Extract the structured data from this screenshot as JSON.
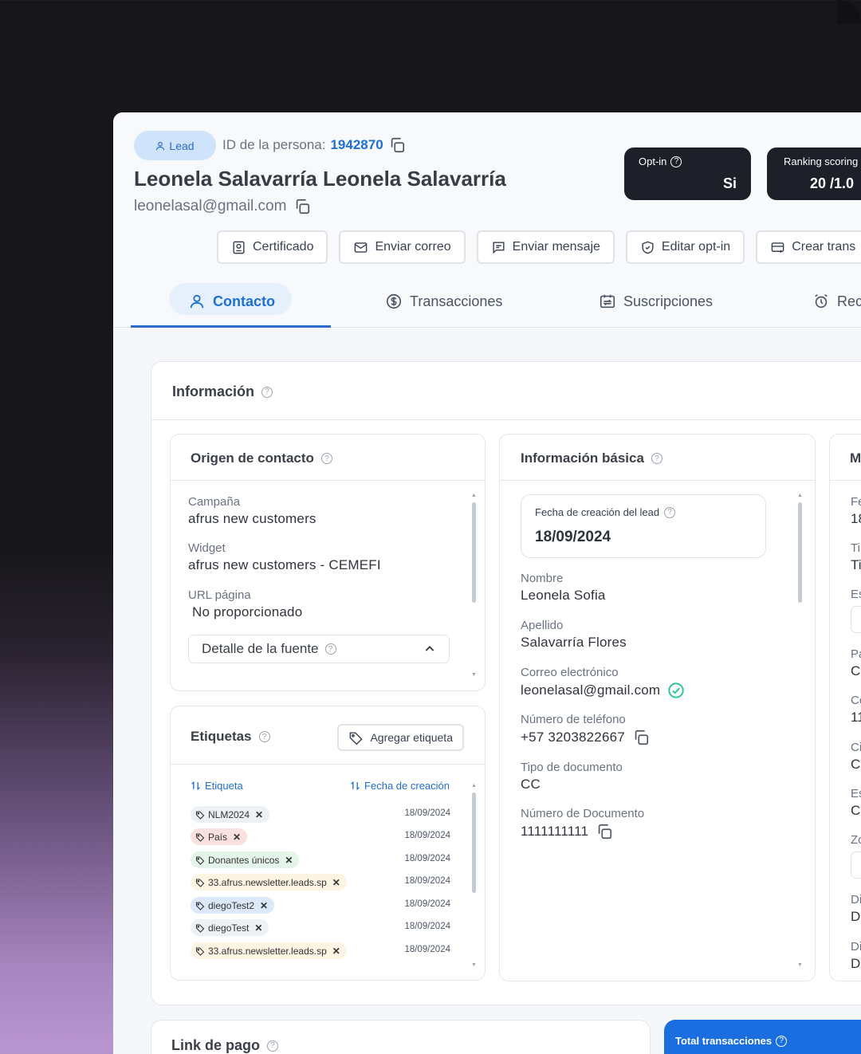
{
  "header": {
    "badge_label": "Lead",
    "person_id_label": "ID de la persona:",
    "person_id_value": "1942870",
    "name": "Leonela Salavarría Leonela Salavarría",
    "email": "leonelasal@gmail.com",
    "optin": {
      "label": "Opt-in",
      "value": "Si"
    },
    "ranking": {
      "label": "Ranking scoring",
      "value": "20  /1.0"
    }
  },
  "actions": {
    "certificado": "Certificado",
    "enviar_correo": "Enviar correo",
    "enviar_mensaje": "Enviar mensaje",
    "editar_optin": "Editar opt-in",
    "crear_trans": "Crear trans"
  },
  "tabs": {
    "contacto": "Contacto",
    "transacciones": "Transacciones",
    "suscripciones": "Suscripciones",
    "rec": "Rec"
  },
  "informacion": {
    "title": "Información",
    "origen": {
      "title": "Origen de contacto",
      "campana_label": "Campaña",
      "campana_value": "afrus new customers",
      "widget_label": "Widget",
      "widget_value": "afrus new customers - CEMEFI",
      "url_label": "URL página",
      "url_value": "No proporcionado",
      "detalle_label": "Detalle de la fuente"
    },
    "etiquetas": {
      "title": "Etiquetas",
      "add_label": "Agregar etiqueta",
      "col_tag": "Etiqueta",
      "col_date": "Fecha de creación",
      "rows": [
        {
          "tag": "NLM2024",
          "date": "18/09/2024",
          "color": "#eef1f4"
        },
        {
          "tag": "País",
          "date": "18/09/2024",
          "color": "#fbe0e0"
        },
        {
          "tag": "Donantes únicos",
          "date": "18/09/2024",
          "color": "#e4f6ea"
        },
        {
          "tag": "33.afrus.newsletter.leads.sp",
          "date": "18/09/2024",
          "color": "#fdf4e4"
        },
        {
          "tag": "diegoTest2",
          "date": "18/09/2024",
          "color": "#dbe9fb"
        },
        {
          "tag": "diegoTest",
          "date": "18/09/2024",
          "color": "#eef1f4"
        },
        {
          "tag": "33.afrus.newsletter.leads.sp",
          "date": "18/09/2024",
          "color": "#fdf4e4"
        }
      ]
    },
    "basica": {
      "title": "Información básica",
      "fecha_label": "Fecha de creación del lead",
      "fecha_value": "18/09/2024",
      "nombre_label": "Nombre",
      "nombre_value": "Leonela Sofia",
      "apellido_label": "Apellido",
      "apellido_value": "Salavarría Flores",
      "correo_label": "Correo electrónico",
      "correo_value": "leonelasal@gmail.com",
      "telefono_label": "Número de teléfono",
      "telefono_value": "+57 3203822667",
      "tipo_doc_label": "Tipo de documento",
      "tipo_doc_value": "CC",
      "num_doc_label": "Número de Documento",
      "num_doc_value": "1111111111"
    },
    "third": {
      "title_fragment": "M",
      "fragments": [
        "Fe",
        "18",
        "Ti",
        "Ti",
        "Es",
        "Pa",
        "Cc",
        "Cc",
        "11",
        "Ci",
        "Cc",
        "Es",
        "Cc",
        "Zc",
        "Di",
        "Di",
        "Di",
        "Di"
      ]
    }
  },
  "bottom": {
    "link_pago": "Link de pago",
    "total_transacciones": "Total transacciones"
  },
  "colors": {
    "accent": "#1f6fd1",
    "dark_card": "#1d2028",
    "blue_card": "#1a6ee0",
    "verified": "#22c58b"
  }
}
